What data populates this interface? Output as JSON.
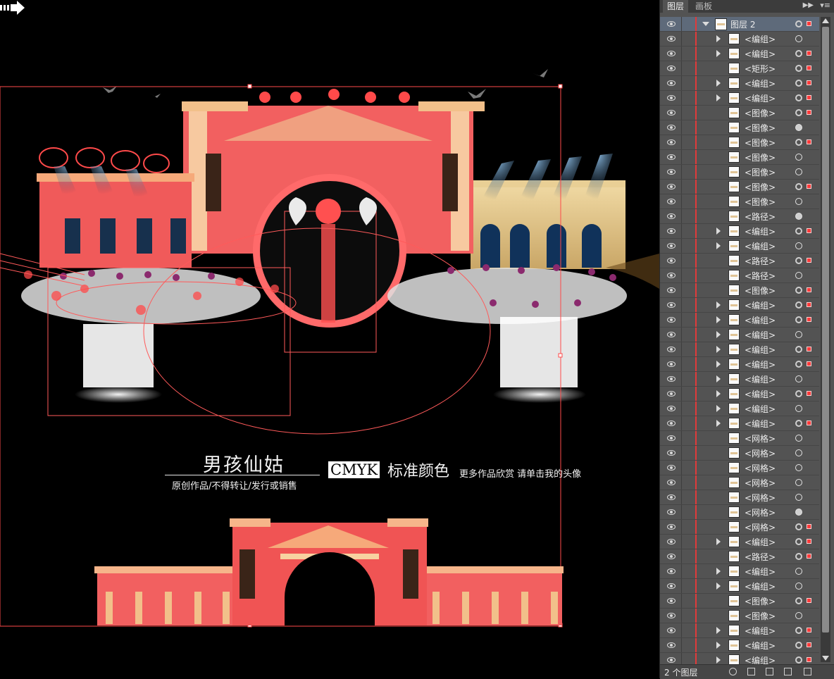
{
  "artboard": {
    "caption_title": "男孩仙姑",
    "caption_subtitle": "原创作品/不得转让/发行或销售",
    "cmyk_label": "CMYK",
    "cmyk_rest": "标准颜色",
    "more_text": "更多作品欣赏 请单击我的头像",
    "arrow_icon": "right-arrow-icon",
    "colors": {
      "selection": "#ff4a4a",
      "gold": "#e8c98a",
      "dark_brown": "#3a2418",
      "flower_purple": "#8b2a6e"
    }
  },
  "panel": {
    "tabs": [
      "图层",
      "画板"
    ],
    "active_tab": "图层",
    "header_layer": "图层 2",
    "footer_count": "2 个图层",
    "colors": {
      "background": "#535353",
      "layer_color": "#e03a3a"
    },
    "rows": [
      {
        "label": "<编组>",
        "expand": true,
        "target": "hollow",
        "selected": false
      },
      {
        "label": "<编组>",
        "expand": true,
        "target": "ring",
        "selected": true
      },
      {
        "label": "<矩形>",
        "expand": false,
        "target": "ring",
        "selected": true
      },
      {
        "label": "<编组>",
        "expand": true,
        "target": "ring",
        "selected": true
      },
      {
        "label": "<编组>",
        "expand": true,
        "target": "ring",
        "selected": true
      },
      {
        "label": "<图像>",
        "expand": false,
        "target": "ring",
        "selected": true
      },
      {
        "label": "<图像>",
        "expand": false,
        "target": "filled",
        "selected": false
      },
      {
        "label": "<图像>",
        "expand": false,
        "target": "ring",
        "selected": true
      },
      {
        "label": "<图像>",
        "expand": false,
        "target": "hollow",
        "selected": false
      },
      {
        "label": "<图像>",
        "expand": false,
        "target": "hollow",
        "selected": false
      },
      {
        "label": "<图像>",
        "expand": false,
        "target": "ring",
        "selected": true
      },
      {
        "label": "<图像>",
        "expand": false,
        "target": "hollow",
        "selected": false
      },
      {
        "label": "<路径>",
        "expand": false,
        "target": "filled",
        "selected": false
      },
      {
        "label": "<编组>",
        "expand": true,
        "target": "ring",
        "selected": true
      },
      {
        "label": "<编组>",
        "expand": true,
        "target": "hollow",
        "selected": false
      },
      {
        "label": "<路径>",
        "expand": false,
        "target": "ring",
        "selected": true
      },
      {
        "label": "<路径>",
        "expand": false,
        "target": "hollow",
        "selected": false
      },
      {
        "label": "<图像>",
        "expand": false,
        "target": "ring",
        "selected": true
      },
      {
        "label": "<编组>",
        "expand": true,
        "target": "ring",
        "selected": true
      },
      {
        "label": "<编组>",
        "expand": true,
        "target": "ring",
        "selected": true
      },
      {
        "label": "<编组>",
        "expand": true,
        "target": "hollow",
        "selected": false
      },
      {
        "label": "<编组>",
        "expand": true,
        "target": "ring",
        "selected": true
      },
      {
        "label": "<编组>",
        "expand": true,
        "target": "ring",
        "selected": true
      },
      {
        "label": "<编组>",
        "expand": true,
        "target": "hollow",
        "selected": false
      },
      {
        "label": "<编组>",
        "expand": true,
        "target": "ring",
        "selected": true
      },
      {
        "label": "<编组>",
        "expand": true,
        "target": "hollow",
        "selected": false
      },
      {
        "label": "<编组>",
        "expand": true,
        "target": "ring",
        "selected": true
      },
      {
        "label": "<网格>",
        "expand": false,
        "target": "hollow",
        "selected": false
      },
      {
        "label": "<网格>",
        "expand": false,
        "target": "hollow",
        "selected": false
      },
      {
        "label": "<网格>",
        "expand": false,
        "target": "hollow",
        "selected": false
      },
      {
        "label": "<网格>",
        "expand": false,
        "target": "hollow",
        "selected": false
      },
      {
        "label": "<网格>",
        "expand": false,
        "target": "hollow",
        "selected": false
      },
      {
        "label": "<网格>",
        "expand": false,
        "target": "filled",
        "selected": false
      },
      {
        "label": "<网格>",
        "expand": false,
        "target": "ring",
        "selected": true
      },
      {
        "label": "<编组>",
        "expand": true,
        "target": "ring",
        "selected": true
      },
      {
        "label": "<路径>",
        "expand": false,
        "target": "ring",
        "selected": true
      },
      {
        "label": "<编组>",
        "expand": true,
        "target": "hollow",
        "selected": false
      },
      {
        "label": "<编组>",
        "expand": true,
        "target": "hollow",
        "selected": false
      },
      {
        "label": "<图像>",
        "expand": false,
        "target": "ring",
        "selected": true
      },
      {
        "label": "<图像>",
        "expand": false,
        "target": "hollow",
        "selected": false
      },
      {
        "label": "<编组>",
        "expand": true,
        "target": "ring",
        "selected": true
      },
      {
        "label": "<编组>",
        "expand": true,
        "target": "ring",
        "selected": true
      },
      {
        "label": "<编组>",
        "expand": true,
        "target": "ring",
        "selected": true
      }
    ]
  }
}
